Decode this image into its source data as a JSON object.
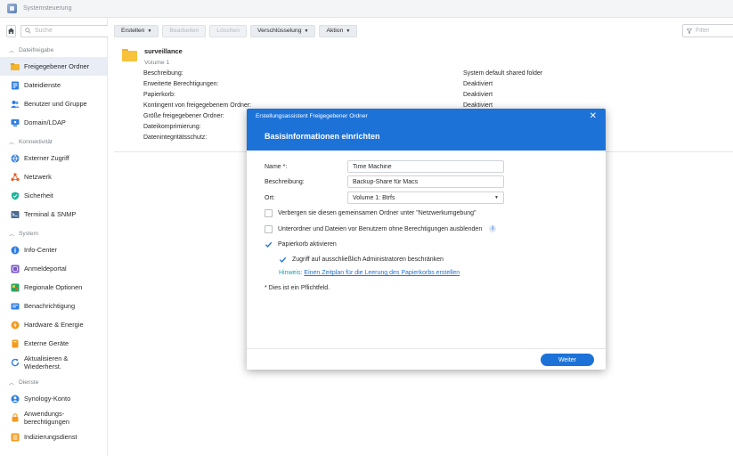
{
  "window": {
    "title": "Systemsteuerung"
  },
  "sidebar": {
    "search_placeholder": "Suche",
    "sections": [
      {
        "label": "Dateifreigabe",
        "items": [
          {
            "label": "Freigegebener Ordner",
            "icon": "folder-icon",
            "active": true
          },
          {
            "label": "Dateidienste",
            "icon": "file-services-icon"
          },
          {
            "label": "Benutzer und Gruppe",
            "icon": "users-icon"
          },
          {
            "label": "Domain/LDAP",
            "icon": "domain-icon"
          }
        ]
      },
      {
        "label": "Konnektivität",
        "items": [
          {
            "label": "Externer Zugriff",
            "icon": "external-access-icon"
          },
          {
            "label": "Netzwerk",
            "icon": "network-icon"
          },
          {
            "label": "Sicherheit",
            "icon": "shield-icon"
          },
          {
            "label": "Terminal & SNMP",
            "icon": "terminal-icon"
          }
        ]
      },
      {
        "label": "System",
        "items": [
          {
            "label": "Info-Center",
            "icon": "info-icon"
          },
          {
            "label": "Anmeldeportal",
            "icon": "login-portal-icon"
          },
          {
            "label": "Regionale Optionen",
            "icon": "regional-icon"
          },
          {
            "label": "Benachrichtigung",
            "icon": "notification-icon"
          },
          {
            "label": "Hardware & Energie",
            "icon": "power-icon"
          },
          {
            "label": "Externe Geräte",
            "icon": "external-devices-icon"
          },
          {
            "label": "Aktualisieren & Wiederherst.",
            "icon": "update-icon"
          }
        ]
      },
      {
        "label": "Dienste",
        "items": [
          {
            "label": "Synology-Konto",
            "icon": "account-icon"
          },
          {
            "label": "Anwendungs-berechtigungen",
            "icon": "app-permissions-icon"
          },
          {
            "label": "Indizierungsdienst",
            "icon": "indexing-icon"
          }
        ]
      }
    ]
  },
  "toolbar": {
    "create": "Erstellen",
    "edit": "Bearbeiten",
    "delete": "Löschen",
    "encryption": "Verschlüsselung",
    "action": "Aktion",
    "filter_placeholder": "Filter"
  },
  "folder": {
    "name": "surveillance",
    "volume": "Volume 1",
    "details": [
      {
        "label": "Beschreibung:",
        "value": "System default shared folder"
      },
      {
        "label": "Erweiterte Berechtigungen:",
        "value": "Deaktiviert"
      },
      {
        "label": "Papierkorb:",
        "value": "Deaktiviert"
      },
      {
        "label": "Kontingent von freigegebenem Ordner:",
        "value": "Deaktiviert"
      },
      {
        "label": "Größe freigegebener Ordner:",
        "value": ""
      },
      {
        "label": "Dateikomprimierung:",
        "value": ""
      },
      {
        "label": "Datenintegritätsschutz:",
        "value": ""
      }
    ]
  },
  "dialog": {
    "title": "Erstellungsassistent Freigegebener Ordner",
    "heading": "Basisinformationen einrichten",
    "fields": {
      "name_label": "Name *:",
      "name_value": "Time Machine",
      "description_label": "Beschreibung:",
      "description_value": "Backup-Share für Macs",
      "location_label": "Ort:",
      "location_value": "Volume 1:  Btrfs"
    },
    "options": {
      "hide_network": "Verbergen sie diesen gemeinsamen Ordner unter \"Netzwerkumgebung\"",
      "hide_subfolders": "Unterordner und Dateien vor Benutzern ohne Berechtigungen ausblenden",
      "recycle_bin": "Papierkorb aktivieren",
      "admin_only": "Zugriff auf ausschließlich Administratoren beschränken"
    },
    "hint_label": "Hinweis:",
    "hint_link": "Einen Zeitplan für die Leerung des Papierkorbs erstellen",
    "required_note": "* Dies ist ein Pflichtfeld.",
    "next_button": "Weiter"
  },
  "colors": {
    "accent": "#1d72d8",
    "sidebar_active": "#e8edf6",
    "folder": "#f7c23c"
  }
}
